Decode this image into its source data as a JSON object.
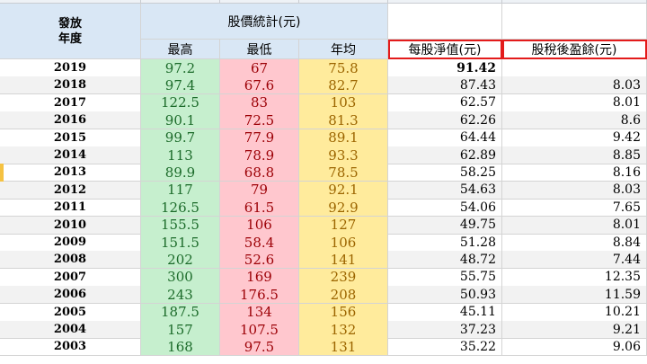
{
  "columns": [
    "A",
    "B",
    "C",
    "D",
    "E",
    "F"
  ],
  "header": {
    "year_label": "發放\n年度",
    "group_label": "股價統計(元)",
    "high_label": "最高",
    "low_label": "最低",
    "avg_label": "年均",
    "bvps_label": "每股淨值(元)",
    "eps_label": "股稅後盈餘(元)"
  },
  "rows": [
    {
      "year": "2019",
      "high": "97.2",
      "low": "67",
      "avg": "75.8",
      "bvps": "91.42",
      "eps": ""
    },
    {
      "year": "2018",
      "high": "97.4",
      "low": "67.6",
      "avg": "82.7",
      "bvps": "87.43",
      "eps": "8.03"
    },
    {
      "year": "2017",
      "high": "122.5",
      "low": "83",
      "avg": "103",
      "bvps": "62.57",
      "eps": "8.01"
    },
    {
      "year": "2016",
      "high": "90.1",
      "low": "72.5",
      "avg": "81.3",
      "bvps": "62.26",
      "eps": "8.6"
    },
    {
      "year": "2015",
      "high": "99.7",
      "low": "77.9",
      "avg": "89.1",
      "bvps": "64.44",
      "eps": "9.42"
    },
    {
      "year": "2014",
      "high": "113",
      "low": "78.9",
      "avg": "93.3",
      "bvps": "62.89",
      "eps": "8.85"
    },
    {
      "year": "2013",
      "high": "89.9",
      "low": "68.8",
      "avg": "78.5",
      "bvps": "58.25",
      "eps": "8.16"
    },
    {
      "year": "2012",
      "high": "117",
      "low": "79",
      "avg": "92.1",
      "bvps": "54.63",
      "eps": "8.03"
    },
    {
      "year": "2011",
      "high": "126.5",
      "low": "61.5",
      "avg": "92.9",
      "bvps": "54.06",
      "eps": "7.65"
    },
    {
      "year": "2010",
      "high": "155.5",
      "low": "106",
      "avg": "127",
      "bvps": "49.75",
      "eps": "8.01"
    },
    {
      "year": "2009",
      "high": "151.5",
      "low": "58.4",
      "avg": "106",
      "bvps": "51.28",
      "eps": "8.84"
    },
    {
      "year": "2008",
      "high": "202",
      "low": "52.6",
      "avg": "141",
      "bvps": "48.72",
      "eps": "7.44"
    },
    {
      "year": "2007",
      "high": "300",
      "low": "169",
      "avg": "239",
      "bvps": "55.75",
      "eps": "12.35"
    },
    {
      "year": "2006",
      "high": "243",
      "low": "176.5",
      "avg": "208",
      "bvps": "50.93",
      "eps": "11.59"
    },
    {
      "year": "2005",
      "high": "187.5",
      "low": "134",
      "avg": "156",
      "bvps": "45.11",
      "eps": "10.21"
    },
    {
      "year": "2004",
      "high": "157",
      "low": "107.5",
      "avg": "132",
      "bvps": "37.23",
      "eps": "9.21"
    },
    {
      "year": "2003",
      "high": "168",
      "low": "97.5",
      "avg": "131",
      "bvps": "35.22",
      "eps": "9.06"
    }
  ],
  "colors": {
    "header_blue": "#d9e7f5",
    "high_fill": "#c6efce",
    "low_fill": "#ffc7ce",
    "avg_fill": "#ffeb9c",
    "highlight_box": "#e31b1b"
  }
}
